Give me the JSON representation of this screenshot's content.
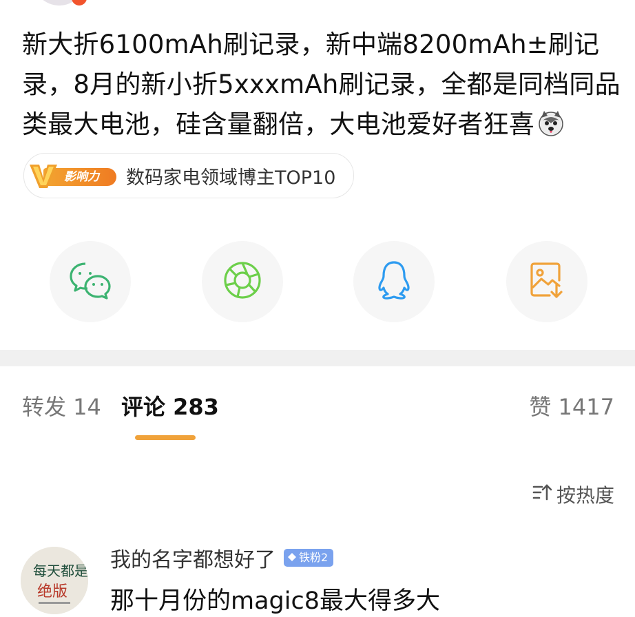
{
  "post": {
    "text": "新大折6100mAh刷记录，新中端8200mAh±刷记录，8月的新小折5xxxmAh刷记录，全都是同档同品类最大电池，硅含量翻倍，大电池爱好者狂喜",
    "emoji": "husky-face-emoji"
  },
  "badge": {
    "logo_text": "影响力",
    "label": "数码家电领域博主TOP10"
  },
  "share": {
    "items": [
      "wechat-icon",
      "moments-icon",
      "qq-icon",
      "save-image-icon"
    ],
    "colors": {
      "wechat": "#3cb371",
      "moments": "#6ccf4a",
      "qq": "#2d9bf0",
      "save": "#f0a23a"
    }
  },
  "tabs": {
    "repost": "转发 14",
    "comments": "评论 283",
    "likes": "赞 1417",
    "accent": "#f0a23a"
  },
  "sort": {
    "label": "按热度"
  },
  "comment": {
    "username": "我的名字都想好了",
    "fan_badge": "铁粉2",
    "text": "那十月份的magic8最大得多大",
    "avatar_text": "每天都是绝版"
  }
}
